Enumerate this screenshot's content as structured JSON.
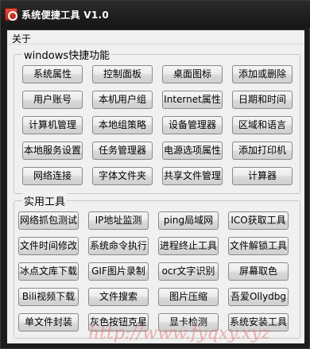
{
  "window": {
    "title": "系统便捷工具 V1.0"
  },
  "menu": {
    "items": [
      "关于"
    ]
  },
  "groups": [
    {
      "title": "windows快捷功能",
      "buttons": [
        "系统属性",
        "控制面板",
        "桌面图标",
        "添加或删除",
        "用户账号",
        "本机用户组",
        "Internet属性",
        "日期和时间",
        "计算机管理",
        "本地组策略",
        "设备管理器",
        "区域和语言",
        "本地服务设置",
        "任务管理器",
        "电源选项属性",
        "添加打印机",
        "网络连接",
        "字体文件夹",
        "共享文件管理",
        "计算器"
      ]
    },
    {
      "title": "实用工具",
      "buttons": [
        "网络抓包测试",
        "IP地址监测",
        "ping局域网",
        "ICO获取工具",
        "文件时间修改",
        "系统命令执行",
        "进程终止工具",
        "文件解锁工具",
        "冰点文库下载",
        "GIF图片录制",
        "ocr文字识别",
        "屏幕取色",
        "Bili视频下载",
        "文件搜索",
        "图片压缩",
        "吾爱Ollydbg",
        "单文件封装",
        "灰色按钮克星",
        "显卡检测",
        "系统安装工具"
      ]
    }
  ],
  "watermark": "http://www.fyqxy.xyz"
}
